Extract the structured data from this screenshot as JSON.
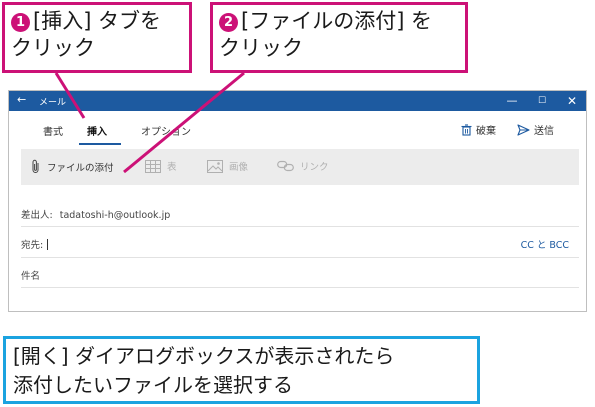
{
  "window": {
    "title": "メール",
    "back_glyph": "←",
    "minimize_glyph": "—",
    "maximize_glyph": "☐",
    "close_glyph": "✕"
  },
  "tabs": [
    {
      "label": "書式",
      "selected": false
    },
    {
      "label": "挿入",
      "selected": true
    },
    {
      "label": "オプション",
      "selected": false
    }
  ],
  "actions": {
    "discard": {
      "label": "破棄",
      "icon": "trash-icon"
    },
    "send": {
      "label": "送信",
      "icon": "send-icon"
    }
  },
  "ribbon": {
    "attach": {
      "label": "ファイルの添付",
      "icon": "paperclip-icon",
      "enabled": true
    },
    "table": {
      "label": "表",
      "icon": "table-icon",
      "enabled": false
    },
    "image": {
      "label": "画像",
      "icon": "image-icon",
      "enabled": false
    },
    "link": {
      "label": "リンク",
      "icon": "link-icon",
      "enabled": false
    }
  },
  "compose": {
    "from_label": "差出人:",
    "from_value": "tadatoshi-h@outlook.jp",
    "to_label": "宛先:",
    "cc_bcc_label": "CC と BCC",
    "subject_label": "件名"
  },
  "callouts": {
    "step1": {
      "number": "1",
      "line1": "[挿入] タブを",
      "line2": "クリック"
    },
    "step2": {
      "number": "2",
      "line1": "[ファイルの添付] を",
      "line2": "クリック"
    }
  },
  "note": {
    "line1": "[開く] ダイアログボックスが表示されたら",
    "line2": "添付したいファイルを選択する"
  },
  "colors": {
    "titlebar": "#1d5aa0",
    "callout_border": "#cc1177",
    "note_border": "#1ba3e0",
    "link": "#1d5aa0"
  }
}
